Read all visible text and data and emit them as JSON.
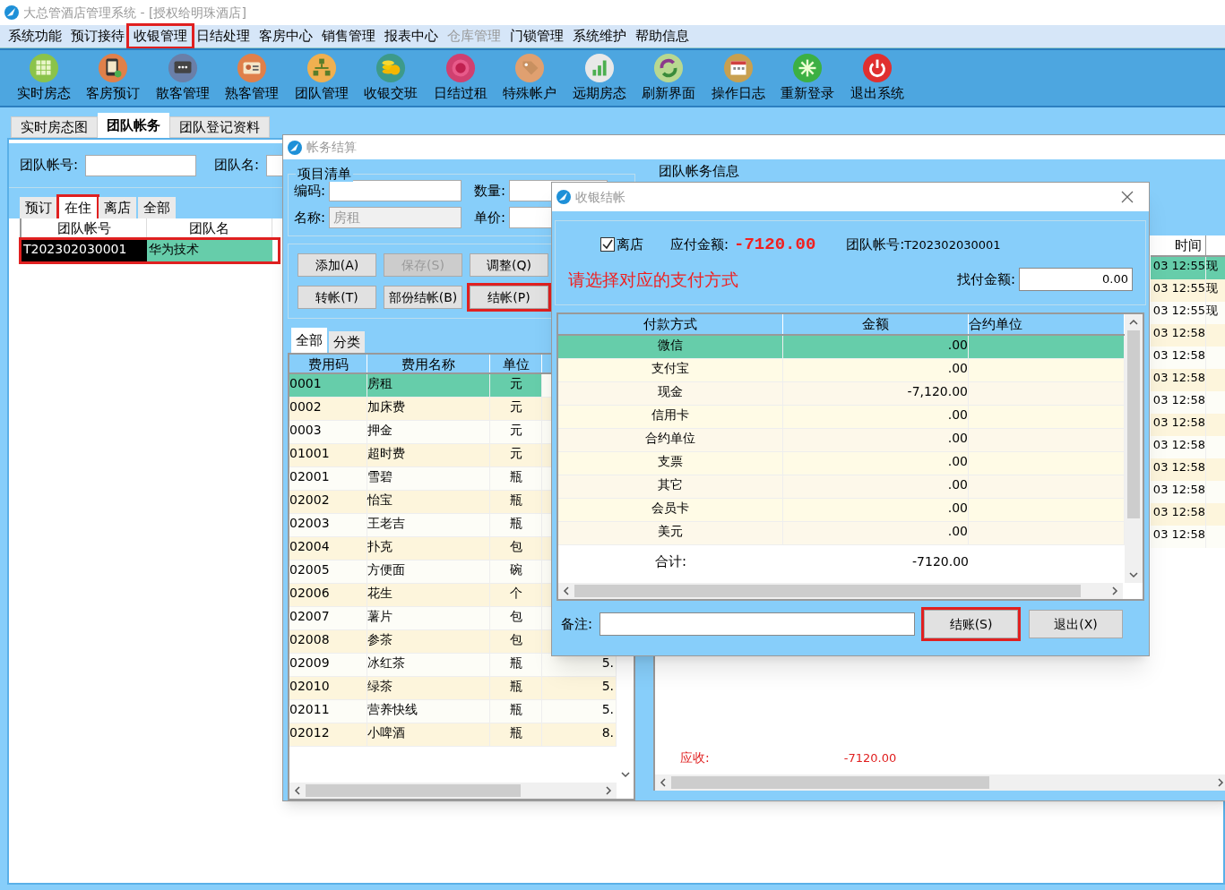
{
  "window": {
    "title": "大总管酒店管理系统 - [授权给明珠酒店]"
  },
  "menu": [
    {
      "label": "系统功能",
      "disabled": false,
      "highlighted": false
    },
    {
      "label": "预订接待",
      "disabled": false,
      "highlighted": false
    },
    {
      "label": "收银管理",
      "disabled": false,
      "highlighted": true
    },
    {
      "label": "日结处理",
      "disabled": false,
      "highlighted": false
    },
    {
      "label": "客房中心",
      "disabled": false,
      "highlighted": false
    },
    {
      "label": "销售管理",
      "disabled": false,
      "highlighted": false
    },
    {
      "label": "报表中心",
      "disabled": false,
      "highlighted": false
    },
    {
      "label": "仓库管理",
      "disabled": true,
      "highlighted": false
    },
    {
      "label": "门锁管理",
      "disabled": false,
      "highlighted": false
    },
    {
      "label": "系统维护",
      "disabled": false,
      "highlighted": false
    },
    {
      "label": "帮助信息",
      "disabled": false,
      "highlighted": false
    }
  ],
  "toolbar": [
    {
      "label": "实时房态"
    },
    {
      "label": "客房预订"
    },
    {
      "label": "散客管理"
    },
    {
      "label": "熟客管理"
    },
    {
      "label": "团队管理"
    },
    {
      "label": "收银交班"
    },
    {
      "label": "日结过租"
    },
    {
      "label": "特殊帐户"
    },
    {
      "label": "远期房态"
    },
    {
      "label": "刷新界面"
    },
    {
      "label": "操作日志"
    },
    {
      "label": "重新登录"
    },
    {
      "label": "退出系统"
    }
  ],
  "main_tabs": [
    {
      "label": "实时房态图",
      "selected": false
    },
    {
      "label": "团队帐务",
      "selected": true
    },
    {
      "label": "团队登记资料",
      "selected": false
    }
  ],
  "group_search": {
    "account_label": "团队帐号:",
    "name_label": "团队名:"
  },
  "status_tabs": [
    {
      "label": "预订",
      "selected": false,
      "highlighted": false
    },
    {
      "label": "在住",
      "selected": true,
      "highlighted": true
    },
    {
      "label": "离店",
      "selected": false,
      "highlighted": false
    },
    {
      "label": "全部",
      "selected": false,
      "highlighted": false
    }
  ],
  "group_table": {
    "columns": [
      "团队帐号",
      "团队名"
    ],
    "rows": [
      {
        "cells": [
          "T202302030001",
          "华为技术"
        ],
        "selected": true,
        "highlighted": true
      }
    ]
  },
  "billing_window": {
    "title": "帐务结算",
    "items_group": "项目清单",
    "fields": [
      {
        "label": "编码:",
        "disabled": false
      },
      {
        "label": "数量:",
        "disabled": false
      },
      {
        "label": "名称:",
        "value": "房租",
        "disabled": true
      },
      {
        "label": "单价:",
        "disabled": false
      }
    ],
    "buttons": [
      {
        "label": "添加(A)",
        "disabled": false,
        "highlighted": false
      },
      {
        "label": "保存(S)",
        "disabled": true,
        "highlighted": false
      },
      {
        "label": "调整(Q)",
        "disabled": false,
        "highlighted": false
      },
      {
        "label": "转帐(T)",
        "disabled": false,
        "highlighted": false
      },
      {
        "label": "部份结帐(B)",
        "disabled": false,
        "highlighted": false
      },
      {
        "label": "结帐(P)",
        "disabled": false,
        "highlighted": true
      }
    ],
    "tabs": [
      {
        "label": "全部",
        "selected": true
      },
      {
        "label": "分类",
        "selected": false
      }
    ],
    "table": {
      "columns": [
        "费用码",
        "费用名称",
        "单位"
      ],
      "rows": [
        {
          "cells": [
            "0001",
            "房租",
            "元"
          ],
          "selected": true
        },
        {
          "cells": [
            "0002",
            "加床费",
            "元"
          ],
          "selected": false
        },
        {
          "cells": [
            "0003",
            "押金",
            "元"
          ],
          "selected": false
        },
        {
          "cells": [
            "01001",
            "超时费",
            "元"
          ],
          "selected": false
        },
        {
          "cells": [
            "02001",
            "雪碧",
            "瓶"
          ],
          "selected": false
        },
        {
          "cells": [
            "02002",
            "怡宝",
            "瓶"
          ],
          "selected": false
        },
        {
          "cells": [
            "02003",
            "王老吉",
            "瓶"
          ],
          "selected": false
        },
        {
          "cells": [
            "02004",
            "扑克",
            "包"
          ],
          "selected": false
        },
        {
          "cells": [
            "02005",
            "方便面",
            "碗"
          ],
          "selected": false
        },
        {
          "cells": [
            "02006",
            "花生",
            "个"
          ],
          "selected": false
        },
        {
          "cells": [
            "02007",
            "薯片",
            "包"
          ],
          "selected": false
        },
        {
          "cells": [
            "02008",
            "参茶",
            "包"
          ],
          "selected": false
        },
        {
          "cells": [
            "02009",
            "冰红茶",
            "瓶",
            "5."
          ],
          "selected": false
        },
        {
          "cells": [
            "02010",
            "绿茶",
            "瓶",
            "5."
          ],
          "selected": false
        },
        {
          "cells": [
            "02011",
            "营养快线",
            "瓶",
            "5."
          ],
          "selected": false
        },
        {
          "cells": [
            "02012",
            "小啤酒",
            "瓶",
            "8."
          ],
          "selected": false
        }
      ]
    },
    "account_info": {
      "title": "团队帐务信息",
      "columns": [
        "时间"
      ],
      "rows": [
        {
          "cells": [
            "03 12:55",
            "现"
          ],
          "selected": true
        },
        {
          "cells": [
            "03 12:55",
            "现"
          ],
          "selected": false
        },
        {
          "cells": [
            "03 12:55",
            "现"
          ],
          "selected": false
        },
        {
          "cells": [
            "03 12:58"
          ],
          "selected": false
        },
        {
          "cells": [
            "03 12:58"
          ],
          "selected": false
        },
        {
          "cells": [
            "03 12:58"
          ],
          "selected": false
        },
        {
          "cells": [
            "03 12:58"
          ],
          "selected": false
        },
        {
          "cells": [
            "03 12:58"
          ],
          "selected": false
        },
        {
          "cells": [
            "03 12:58"
          ],
          "selected": false
        },
        {
          "cells": [
            "03 12:58"
          ],
          "selected": false
        },
        {
          "cells": [
            "03 12:58"
          ],
          "selected": false
        },
        {
          "cells": [
            "03 12:58"
          ],
          "selected": false
        },
        {
          "cells": [
            "03 12:58"
          ],
          "selected": false
        }
      ],
      "receivable_label": "应收:",
      "receivable": "-7120.00"
    }
  },
  "dialog": {
    "title": "收银结帐",
    "leave": {
      "label": "离店",
      "checked": true
    },
    "due_label": "应付金额:",
    "due": "-7120.00",
    "account_label": "团队帐号:",
    "account": "T202302030001",
    "prompt": "请选择对应的支付方式",
    "change_label": "找付金额:",
    "change": "0.00",
    "columns": [
      "付款方式",
      "金额",
      "合约单位"
    ],
    "rows": [
      {
        "cells": [
          "微信",
          ".00"
        ],
        "selected": true
      },
      {
        "cells": [
          "支付宝",
          ".00"
        ],
        "selected": false
      },
      {
        "cells": [
          "现金",
          "-7,120.00"
        ],
        "selected": false
      },
      {
        "cells": [
          "信用卡",
          ".00"
        ],
        "selected": false
      },
      {
        "cells": [
          "合约单位",
          ".00"
        ],
        "selected": false
      },
      {
        "cells": [
          "支票",
          ".00"
        ],
        "selected": false
      },
      {
        "cells": [
          "其它",
          ".00"
        ],
        "selected": false
      },
      {
        "cells": [
          "会员卡",
          ".00"
        ],
        "selected": false
      },
      {
        "cells": [
          "美元",
          ".00"
        ],
        "selected": false
      }
    ],
    "total_label": "合计:",
    "total": "-7120.00",
    "note_label": "备注:",
    "buttons": [
      {
        "label": "结账(S)",
        "highlighted": true
      },
      {
        "label": "退出(X)",
        "highlighted": false
      }
    ]
  }
}
